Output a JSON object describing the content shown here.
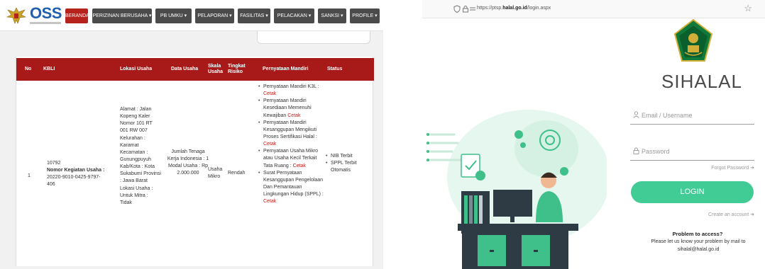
{
  "oss": {
    "brand": "OSS",
    "nav": [
      {
        "label": "BERANDA",
        "active": true
      },
      {
        "label": "PERIZINAN BERUSAHA ▾",
        "active": false
      },
      {
        "label": "PB UMKU ▾",
        "active": false
      },
      {
        "label": "PELAPORAN ▾",
        "active": false
      },
      {
        "label": "FASILITAS ▾",
        "active": false
      },
      {
        "label": "PELACAKAN ▾",
        "active": false
      },
      {
        "label": "SANKSI ▾",
        "active": false
      },
      {
        "label": "PROFILE ▾",
        "active": false
      }
    ],
    "table": {
      "headers": {
        "no": "No",
        "kbli": "KBLI",
        "lokasi": "Lokasi Usaha",
        "data": "Data Usaha",
        "skala": "Skala Usaha",
        "tingkat": "Tingkat Risiko",
        "pernyataan": "Pernyataan Mandiri",
        "status": "Status"
      },
      "row": {
        "no": "1",
        "kbli_code": "10792",
        "kbli_label": "Nomor Kegiatan Usaha :",
        "kbli_number": "20220-9010-0425-9797-406",
        "lokasi": "Alamat : Jalan Kopeng Kaler Nomor 101 RT 001 RW 007 Kelurahan : Karamat Kecamatan : Gunungpuyuh Kab/Kota : Kota Sukabumi Provinsi : Jawa Barat Lokasi Usaha : Untuk Mitra : Tidak",
        "data_usaha": "Jumlah Tenaga Kerja Indonesia : 1 Modal Usaha : Rp 2.000.000",
        "skala": "Usaha Mikro",
        "tingkat": "Rendah",
        "pernyataan": [
          {
            "text": "Pernyataan Mandiri K3L : ",
            "link": "Cetak"
          },
          {
            "text": "Pernyataan Mandiri Kesediaan Memenuhi Kewajiban ",
            "link": "Cetak"
          },
          {
            "text": "Pernyataan Mandiri Kesanggupan Mengikuti Proses Sertifikasi Halal : ",
            "link": "Cetak"
          },
          {
            "text": "Pernyataan Usaha Mikro atau Usaha Kecil Terkait Tata Ruang : ",
            "link": "Cetak"
          },
          {
            "text": "Surat Pernyataan Kesanggupan Pengelolaan Dan Pemantauan Lingkungan Hidup (SPPL) : ",
            "link": "Cetak"
          }
        ],
        "status": [
          "NIB Terbit",
          "SPPL Terbit Otomatis"
        ]
      }
    }
  },
  "sihalal": {
    "url_prefix": "https://ptsp.",
    "url_bold": "halal.go.id",
    "url_suffix": "/login.aspx",
    "title": "SIHALAL",
    "email_placeholder": "Email / Username",
    "password_placeholder": "Password",
    "forgot": "Forgot Password ➜",
    "login": "LOGIN",
    "create": "Create an account ➜",
    "problem_title": "Problem to access?",
    "problem_msg": "Please let us know your problem by mail to sihalal@halal.go.id",
    "colors": {
      "button": "#41cc96",
      "accent": "#3fbf8a",
      "oss_red": "#a8191a"
    }
  }
}
